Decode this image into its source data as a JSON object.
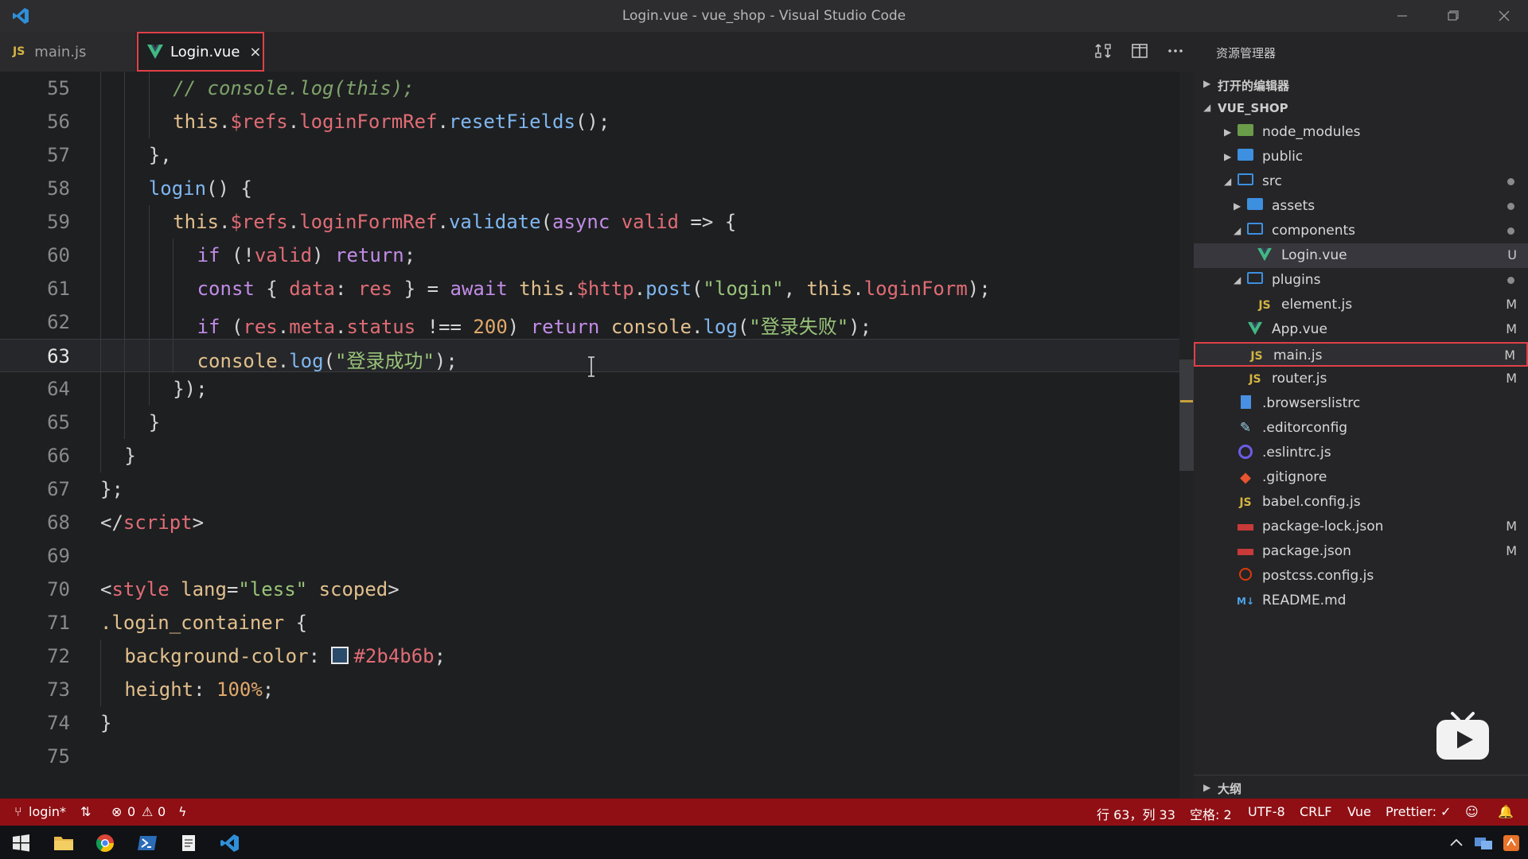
{
  "window": {
    "title": "Login.vue - vue_shop - Visual Studio Code",
    "controls": [
      "minimize",
      "restore",
      "close"
    ]
  },
  "tabs": [
    {
      "badge": "JS",
      "label": "main.js",
      "active": false
    },
    {
      "badge": "V",
      "label": "Login.vue",
      "active": true,
      "close": "×"
    }
  ],
  "editor": {
    "lines": [
      {
        "num": "55",
        "indent": 3,
        "tokens": [
          {
            "t": "// console.log(this);",
            "c": "com"
          }
        ]
      },
      {
        "num": "56",
        "indent": 3,
        "tokens": [
          {
            "t": "this",
            "c": "kw"
          },
          {
            "t": ".",
            "c": "p"
          },
          {
            "t": "$refs",
            "c": "var"
          },
          {
            "t": ".",
            "c": "p"
          },
          {
            "t": "loginFormRef",
            "c": "var"
          },
          {
            "t": ".",
            "c": "p"
          },
          {
            "t": "resetFields",
            "c": "fn"
          },
          {
            "t": "();",
            "c": "p"
          }
        ]
      },
      {
        "num": "57",
        "indent": 2,
        "tokens": [
          {
            "t": "},",
            "c": "p"
          }
        ]
      },
      {
        "num": "58",
        "indent": 2,
        "tokens": [
          {
            "t": "login",
            "c": "fn"
          },
          {
            "t": "() {",
            "c": "p"
          }
        ]
      },
      {
        "num": "59",
        "indent": 3,
        "tokens": [
          {
            "t": "this",
            "c": "kw"
          },
          {
            "t": ".",
            "c": "p"
          },
          {
            "t": "$refs",
            "c": "var"
          },
          {
            "t": ".",
            "c": "p"
          },
          {
            "t": "loginFormRef",
            "c": "var"
          },
          {
            "t": ".",
            "c": "p"
          },
          {
            "t": "validate",
            "c": "fn"
          },
          {
            "t": "(",
            "c": "p"
          },
          {
            "t": "async",
            "c": "kw2"
          },
          {
            "t": " ",
            "c": "p"
          },
          {
            "t": "valid",
            "c": "var"
          },
          {
            "t": " => {",
            "c": "p"
          }
        ]
      },
      {
        "num": "60",
        "indent": 4,
        "tokens": [
          {
            "t": "if",
            "c": "kw2"
          },
          {
            "t": " (!",
            "c": "p"
          },
          {
            "t": "valid",
            "c": "var"
          },
          {
            "t": ") ",
            "c": "p"
          },
          {
            "t": "return",
            "c": "kw2"
          },
          {
            "t": ";",
            "c": "p"
          }
        ]
      },
      {
        "num": "61",
        "indent": 4,
        "tokens": [
          {
            "t": "const",
            "c": "kw2"
          },
          {
            "t": " { ",
            "c": "p"
          },
          {
            "t": "data",
            "c": "var"
          },
          {
            "t": ": ",
            "c": "p"
          },
          {
            "t": "res",
            "c": "var"
          },
          {
            "t": " } = ",
            "c": "p"
          },
          {
            "t": "await",
            "c": "kw2"
          },
          {
            "t": " ",
            "c": "p"
          },
          {
            "t": "this",
            "c": "kw"
          },
          {
            "t": ".",
            "c": "p"
          },
          {
            "t": "$http",
            "c": "var"
          },
          {
            "t": ".",
            "c": "p"
          },
          {
            "t": "post",
            "c": "fn"
          },
          {
            "t": "(",
            "c": "p"
          },
          {
            "t": "\"login\"",
            "c": "str"
          },
          {
            "t": ", ",
            "c": "p"
          },
          {
            "t": "this",
            "c": "kw"
          },
          {
            "t": ".",
            "c": "p"
          },
          {
            "t": "loginForm",
            "c": "var"
          },
          {
            "t": ");",
            "c": "p"
          }
        ]
      },
      {
        "num": "62",
        "indent": 4,
        "tokens": [
          {
            "t": "if",
            "c": "kw2"
          },
          {
            "t": " (",
            "c": "p"
          },
          {
            "t": "res",
            "c": "var"
          },
          {
            "t": ".",
            "c": "p"
          },
          {
            "t": "meta",
            "c": "var"
          },
          {
            "t": ".",
            "c": "p"
          },
          {
            "t": "status",
            "c": "var"
          },
          {
            "t": " !== ",
            "c": "p"
          },
          {
            "t": "200",
            "c": "num"
          },
          {
            "t": ") ",
            "c": "p"
          },
          {
            "t": "return",
            "c": "kw2"
          },
          {
            "t": " ",
            "c": "p"
          },
          {
            "t": "console",
            "c": "kw"
          },
          {
            "t": ".",
            "c": "p"
          },
          {
            "t": "log",
            "c": "fn"
          },
          {
            "t": "(",
            "c": "p"
          },
          {
            "t": "\"登录失败\"",
            "c": "str"
          },
          {
            "t": ");",
            "c": "p"
          }
        ]
      },
      {
        "num": "63",
        "indent": 4,
        "current": true,
        "tokens": [
          {
            "t": "console",
            "c": "kw"
          },
          {
            "t": ".",
            "c": "p"
          },
          {
            "t": "log",
            "c": "fn"
          },
          {
            "t": "(",
            "c": "p"
          },
          {
            "t": "\"登录成功\"",
            "c": "str"
          },
          {
            "t": ");",
            "c": "p"
          }
        ]
      },
      {
        "num": "64",
        "indent": 3,
        "tokens": [
          {
            "t": "});",
            "c": "p"
          }
        ]
      },
      {
        "num": "65",
        "indent": 2,
        "tokens": [
          {
            "t": "}",
            "c": "p"
          }
        ]
      },
      {
        "num": "66",
        "indent": 1,
        "tokens": [
          {
            "t": "}",
            "c": "p"
          }
        ]
      },
      {
        "num": "67",
        "indent": 0,
        "tokens": [
          {
            "t": "};",
            "c": "p"
          }
        ]
      },
      {
        "num": "68",
        "indent": 0,
        "tokens": [
          {
            "t": "</",
            "c": "p"
          },
          {
            "t": "script",
            "c": "tag"
          },
          {
            "t": ">",
            "c": "p"
          }
        ]
      },
      {
        "num": "69",
        "indent": 0,
        "tokens": []
      },
      {
        "num": "70",
        "indent": 0,
        "tokens": [
          {
            "t": "<",
            "c": "p"
          },
          {
            "t": "style",
            "c": "tag"
          },
          {
            "t": " ",
            "c": "p"
          },
          {
            "t": "lang",
            "c": "attr"
          },
          {
            "t": "=",
            "c": "p"
          },
          {
            "t": "\"less\"",
            "c": "str"
          },
          {
            "t": " ",
            "c": "p"
          },
          {
            "t": "scoped",
            "c": "attr"
          },
          {
            "t": ">",
            "c": "p"
          }
        ]
      },
      {
        "num": "71",
        "indent": 0,
        "tokens": [
          {
            "t": ".login_container",
            "c": "kw"
          },
          {
            "t": " {",
            "c": "p"
          }
        ]
      },
      {
        "num": "72",
        "indent": 1,
        "tokens": [
          {
            "t": "background-color",
            "c": "attr"
          },
          {
            "t": ": ",
            "c": "p"
          },
          {
            "t": "",
            "c": "swatch"
          },
          {
            "t": "#2b4b6b",
            "c": "tag"
          },
          {
            "t": ";",
            "c": "p"
          }
        ]
      },
      {
        "num": "73",
        "indent": 1,
        "tokens": [
          {
            "t": "height",
            "c": "attr"
          },
          {
            "t": ": ",
            "c": "p"
          },
          {
            "t": "100%",
            "c": "num"
          },
          {
            "t": ";",
            "c": "p"
          }
        ]
      },
      {
        "num": "74",
        "indent": 0,
        "tokens": [
          {
            "t": "}",
            "c": "p"
          }
        ]
      },
      {
        "num": "75",
        "indent": 0,
        "tokens": []
      }
    ]
  },
  "explorer": {
    "header": "资源管理器",
    "open_editors": "打开的编辑器",
    "project": "VUE_SHOP",
    "items": [
      {
        "name": "node_modules",
        "depth": 1,
        "type": "folder-node",
        "arrow": "▶"
      },
      {
        "name": "public",
        "depth": 1,
        "type": "folder",
        "arrow": "▶"
      },
      {
        "name": "src",
        "depth": 1,
        "type": "folder-open",
        "arrow": "◢",
        "dot": true
      },
      {
        "name": "assets",
        "depth": 2,
        "type": "folder",
        "arrow": "▶",
        "dot": true
      },
      {
        "name": "components",
        "depth": 2,
        "type": "folder-open",
        "arrow": "◢",
        "dot": true
      },
      {
        "name": "Login.vue",
        "depth": 3,
        "type": "vue",
        "status": "U",
        "selected": true
      },
      {
        "name": "plugins",
        "depth": 2,
        "type": "folder-open",
        "arrow": "◢",
        "dot": true
      },
      {
        "name": "element.js",
        "depth": 3,
        "type": "js",
        "status": "M"
      },
      {
        "name": "App.vue",
        "depth": 2,
        "type": "vue",
        "status": "M"
      },
      {
        "name": "main.js",
        "depth": 2,
        "type": "js",
        "status": "M",
        "highlight": true
      },
      {
        "name": "router.js",
        "depth": 2,
        "type": "js",
        "status": "M"
      },
      {
        "name": ".browserslistrc",
        "depth": 1,
        "type": "file-blue"
      },
      {
        "name": ".editorconfig",
        "depth": 1,
        "type": "editorconfig"
      },
      {
        "name": ".eslintrc.js",
        "depth": 1,
        "type": "eslint"
      },
      {
        "name": ".gitignore",
        "depth": 1,
        "type": "git"
      },
      {
        "name": "babel.config.js",
        "depth": 1,
        "type": "js"
      },
      {
        "name": "package-lock.json",
        "depth": 1,
        "type": "npm",
        "status": "M"
      },
      {
        "name": "package.json",
        "depth": 1,
        "type": "npm",
        "status": "M"
      },
      {
        "name": "postcss.config.js",
        "depth": 1,
        "type": "postcss"
      },
      {
        "name": "README.md",
        "depth": 1,
        "type": "md"
      }
    ],
    "outline": "大纲"
  },
  "statusbar": {
    "branch": "login*",
    "errors": "0",
    "warnings": "0",
    "position": "行 63，列 33",
    "spaces": "空格: 2",
    "encoding": "UTF-8",
    "eol": "CRLF",
    "language": "Vue",
    "prettier": "Prettier: ✓"
  },
  "colors": {
    "statusbar": "#8f0f14",
    "editor_bg": "#1e1f21",
    "kw": "#e2c08d",
    "var": "#e06c75",
    "fn": "#7fb7f0",
    "str": "#98c379",
    "com": "#7fa36b"
  }
}
